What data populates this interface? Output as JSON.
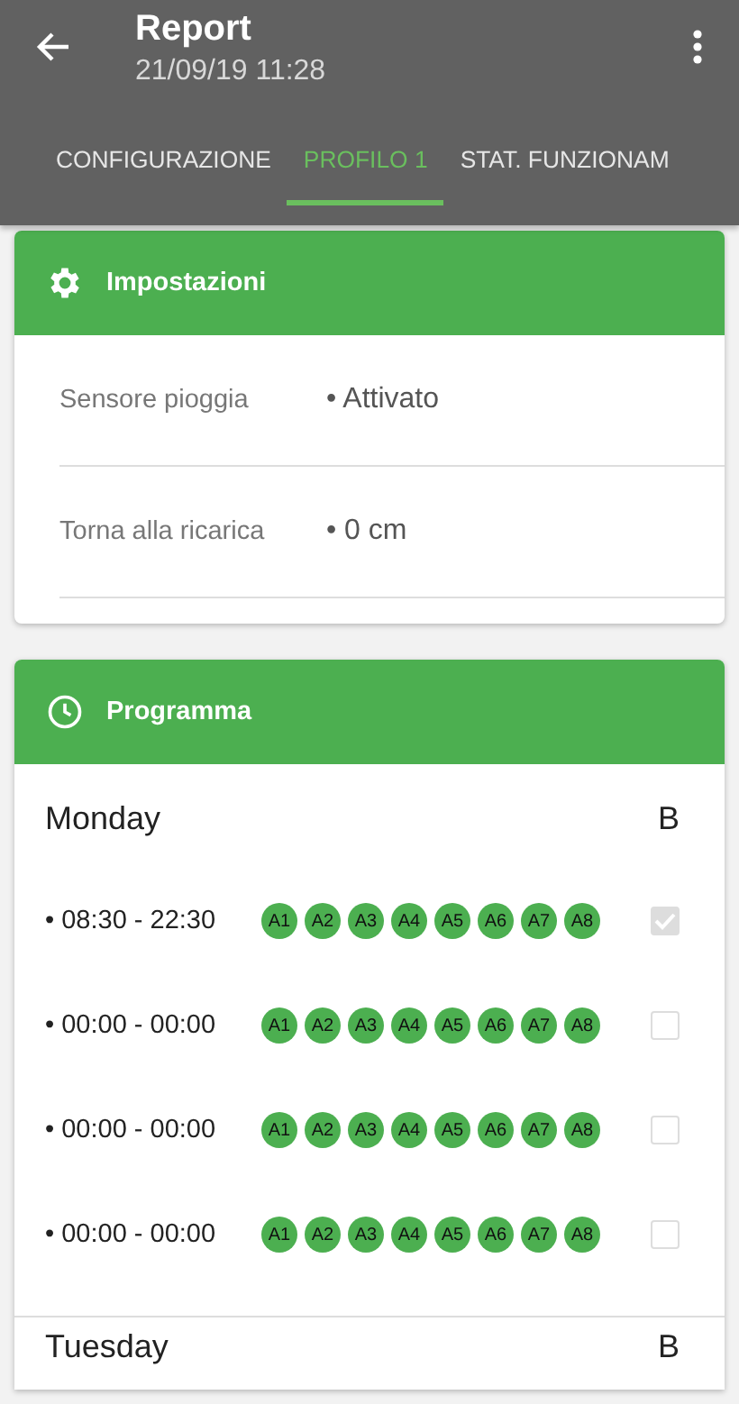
{
  "app_bar": {
    "title": "Report",
    "subtitle": "21/09/19 11:28"
  },
  "tabs": [
    {
      "label": "CONFIGURAZIONE",
      "selected": false
    },
    {
      "label": "PROFILO 1",
      "selected": true
    },
    {
      "label": "STAT. FUNZIONAM",
      "selected": false
    }
  ],
  "settings_card": {
    "title": "Impostazioni",
    "rows": [
      {
        "label": "Sensore pioggia",
        "value": "• Attivato"
      },
      {
        "label": "Torna alla ricarica",
        "value": "• 0 cm"
      }
    ]
  },
  "program_card": {
    "title": "Programma",
    "days": [
      {
        "name": "Monday",
        "column": "B",
        "slots": [
          {
            "time": "• 08:30 - 22:30",
            "areas": [
              "A1",
              "A2",
              "A3",
              "A4",
              "A5",
              "A6",
              "A7",
              "A8"
            ],
            "checked": true
          },
          {
            "time": "• 00:00 - 00:00",
            "areas": [
              "A1",
              "A2",
              "A3",
              "A4",
              "A5",
              "A6",
              "A7",
              "A8"
            ],
            "checked": false
          },
          {
            "time": "• 00:00 - 00:00",
            "areas": [
              "A1",
              "A2",
              "A3",
              "A4",
              "A5",
              "A6",
              "A7",
              "A8"
            ],
            "checked": false
          },
          {
            "time": "• 00:00 - 00:00",
            "areas": [
              "A1",
              "A2",
              "A3",
              "A4",
              "A5",
              "A6",
              "A7",
              "A8"
            ],
            "checked": false
          }
        ]
      },
      {
        "name": "Tuesday",
        "column": "B"
      }
    ]
  }
}
